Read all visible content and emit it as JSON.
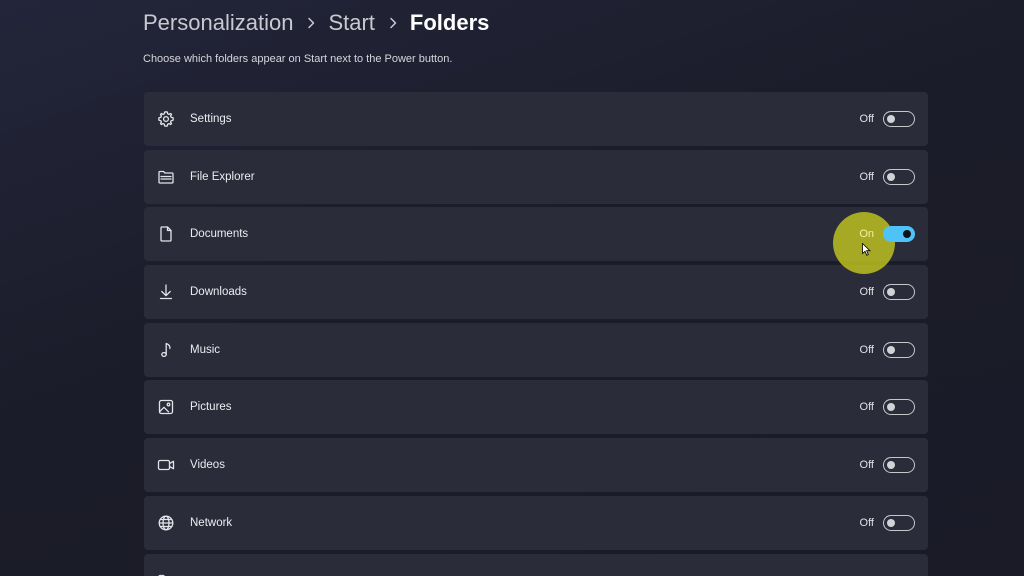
{
  "breadcrumb": {
    "items": [
      "Personalization",
      "Start",
      "Folders"
    ],
    "separator": "›"
  },
  "description": "Choose which folders appear on Start next to the Power button.",
  "colors": {
    "toggle_on": "#4fc3f7",
    "highlight": "#c8cd1e"
  },
  "folders": [
    {
      "label": "Settings",
      "icon": "gear-icon",
      "state": "Off"
    },
    {
      "label": "File Explorer",
      "icon": "folder-icon",
      "state": "Off"
    },
    {
      "label": "Documents",
      "icon": "document-icon",
      "state": "On"
    },
    {
      "label": "Downloads",
      "icon": "download-icon",
      "state": "Off"
    },
    {
      "label": "Music",
      "icon": "music-note-icon",
      "state": "Off"
    },
    {
      "label": "Pictures",
      "icon": "picture-icon",
      "state": "Off"
    },
    {
      "label": "Videos",
      "icon": "video-icon",
      "state": "Off"
    },
    {
      "label": "Network",
      "icon": "globe-icon",
      "state": "Off"
    }
  ]
}
